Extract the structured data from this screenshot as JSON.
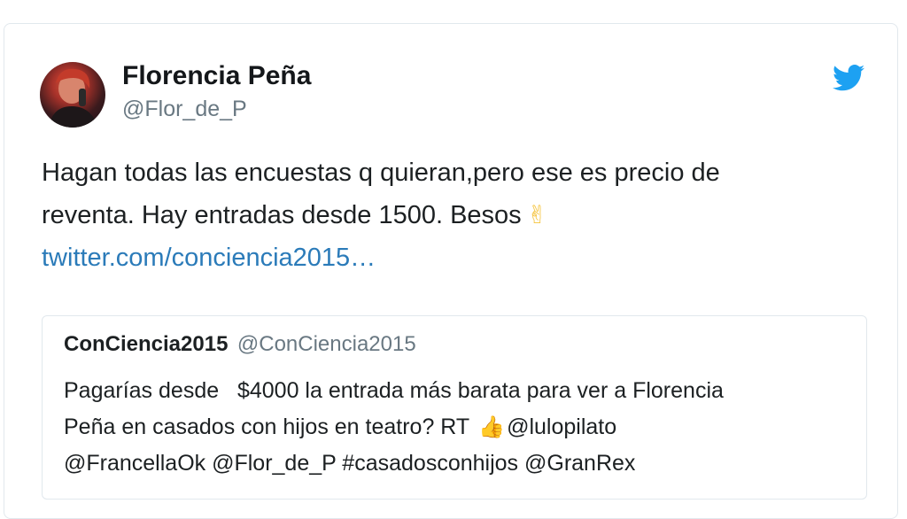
{
  "tweet": {
    "author": {
      "display_name": "Florencia Peña",
      "handle": "@Flor_de_P"
    },
    "text_line1": "Hagan todas las encuestas q quieran,pero ese es precio de",
    "text_line2": "reventa. Hay entradas desde 1500. Besos",
    "emoji": "✌",
    "link": "twitter.com/conciencia2015…",
    "icon": "twitter-bird-icon",
    "colors": {
      "link": "#2b7bb9",
      "bird": "#1da1f2",
      "border": "#e1e8ed"
    }
  },
  "quoted": {
    "display_name": "ConCiencia2015",
    "handle": "@ConCiencia2015",
    "line1": "Pagarías desde   $4000 la entrada más barata para ver a Florencia",
    "line2_a": "Peña en casados con hijos en teatro? RT",
    "line2_emoji": "👍",
    "line2_b": "@lulopilato",
    "line3": "@FrancellaOk @Flor_de_P #casadosconhijos @GranRex"
  }
}
